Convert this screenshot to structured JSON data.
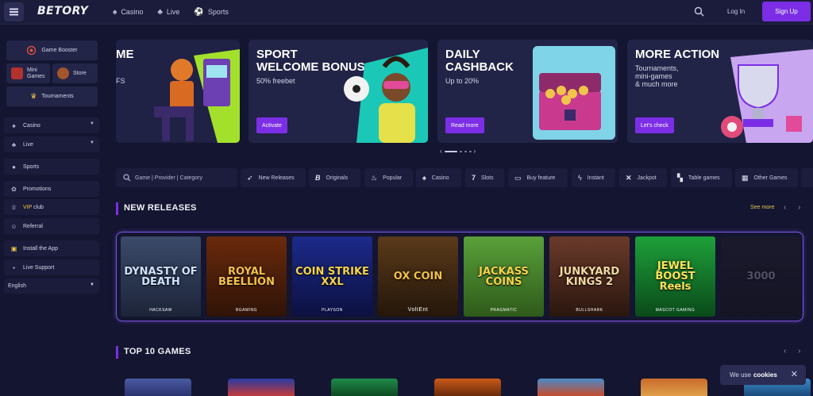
{
  "header": {
    "logo": "BETORY",
    "nav": [
      {
        "label": "Casino",
        "icon": "casino-icon"
      },
      {
        "label": "Live",
        "icon": "live-icon"
      },
      {
        "label": "Sports",
        "icon": "sports-icon"
      }
    ],
    "login_label": "Log In",
    "signup_label": "Sign Up"
  },
  "sidebar": {
    "game_booster": "Game Booster",
    "mini_games": "Mini\nGames",
    "store": "Store",
    "tournaments": "Tournaments",
    "items": [
      {
        "label": "Casino",
        "icon": "spade-icon"
      },
      {
        "label": "Live",
        "icon": "live-icon"
      },
      {
        "label": "Sports",
        "icon": "ball-icon"
      },
      {
        "label": "Promotions",
        "icon": "gift-icon"
      },
      {
        "label": "VIP club",
        "label_vip": "VIP",
        "label_rest": " club",
        "icon": "crown-icon"
      },
      {
        "label": "Referral",
        "icon": "users-icon"
      },
      {
        "label": "Install the App",
        "icon": "download-icon"
      },
      {
        "label": "Live Support",
        "icon": "chat-icon"
      }
    ],
    "language": "English"
  },
  "banners": [
    {
      "title": "ME",
      "subtitle": "FS"
    },
    {
      "title": "SPORT\nWELCOME BONUS",
      "subtitle": "50% freebet",
      "cta": "Activate"
    },
    {
      "title": "DAILY\nCASHBACK",
      "subtitle": "Up to 20%",
      "cta": "Read more"
    },
    {
      "title": "MORE ACTION",
      "subtitle": "Tournaments,\nmini-games\n& much more",
      "cta": "Let's check"
    }
  ],
  "search": {
    "placeholder": "Game | Provider | Category"
  },
  "categories": [
    {
      "label": "New Releases",
      "icon": "rocket-icon"
    },
    {
      "label": "Originals",
      "icon": "b-icon"
    },
    {
      "label": "Popular",
      "icon": "fire-icon"
    },
    {
      "label": "Casino",
      "icon": "spade-icon"
    },
    {
      "label": "Slots",
      "icon": "seven-icon"
    },
    {
      "label": "Buy feature",
      "icon": "cart-icon"
    },
    {
      "label": "Instant",
      "icon": "bolt-icon"
    },
    {
      "label": "Jackpot",
      "icon": "jackpot-icon"
    },
    {
      "label": "Table games",
      "icon": "cards-icon"
    },
    {
      "label": "Other Games",
      "icon": "grid-icon"
    }
  ],
  "new_releases": {
    "title": "NEW RELEASES",
    "see_more": "See more",
    "games": [
      {
        "name": "DYNASTY OF DEATH",
        "provider": "HACKSAW"
      },
      {
        "name": "ROYAL BEELLION",
        "provider": "BGAMING"
      },
      {
        "name": "COIN STRIKE XXL",
        "provider": "PLAYSON"
      },
      {
        "name": "OX COIN",
        "provider": "VoltEnt"
      },
      {
        "name": "JACKASS COINS",
        "provider": "PRAGMATIC"
      },
      {
        "name": "JUNKYARD KINGS 2",
        "provider": "BULLSHARK"
      },
      {
        "name": "JEWEL BOOST Reels",
        "provider": "MASCOT GAMING"
      },
      {
        "name": "3000",
        "provider": ""
      }
    ]
  },
  "top10": {
    "title": "TOP 10 GAMES"
  },
  "cookie": {
    "text": "We use",
    "link": "cookies"
  },
  "colors": {
    "accent": "#7b2ee6",
    "background": "#141530",
    "vip": "#f0c54a"
  }
}
